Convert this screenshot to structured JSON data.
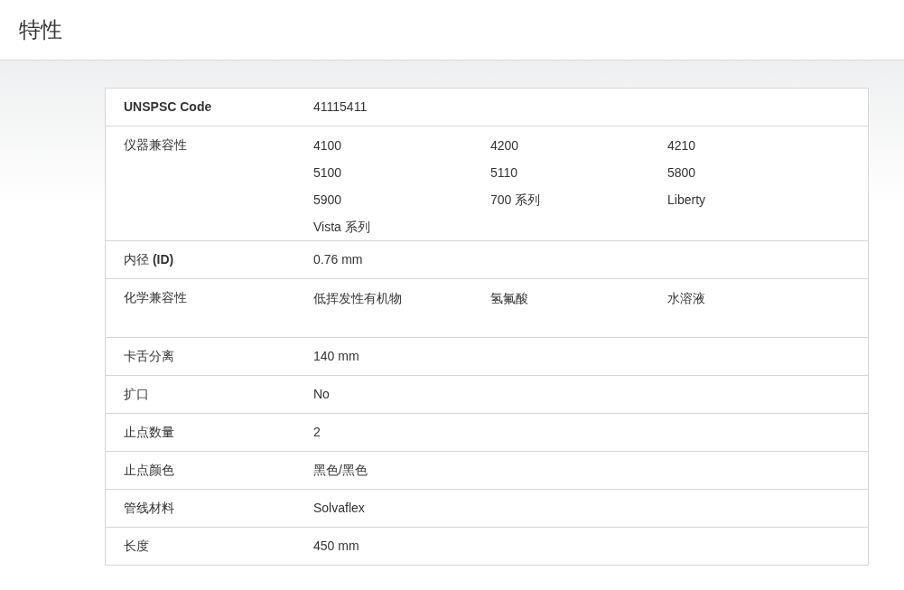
{
  "header": {
    "title": "特性"
  },
  "rows": [
    {
      "label": "UNSPSC Code",
      "bold": true,
      "value": "41115411"
    },
    {
      "label": "仪器兼容性",
      "bold": false,
      "values": [
        "4100",
        "4200",
        "4210",
        "5100",
        "5110",
        "5800",
        "5900",
        "700 系列",
        "Liberty",
        "Vista 系列"
      ]
    },
    {
      "label": "内径 **(ID)**",
      "bold": false,
      "value": "0.76 mm"
    },
    {
      "label": "化学兼容性",
      "bold": false,
      "values": [
        "低挥发性有机物",
        "氢氟酸",
        "水溶液"
      ]
    },
    {
      "label": "卡舌分离",
      "bold": false,
      "value": "140 mm"
    },
    {
      "label": "扩口",
      "bold": false,
      "value": "No"
    },
    {
      "label": "止点数量",
      "bold": false,
      "value": "2"
    },
    {
      "label": "止点颜色",
      "bold": false,
      "value": "黑色/黑色"
    },
    {
      "label": "管线材料",
      "bold": false,
      "value": "Solvaflex"
    },
    {
      "label": "长度",
      "bold": false,
      "value": "450 mm"
    }
  ]
}
